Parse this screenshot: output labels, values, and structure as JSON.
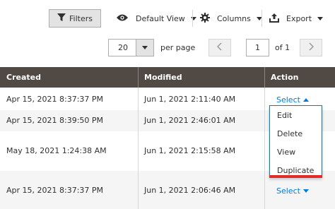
{
  "toolbar": {
    "filters_label": "Filters",
    "view_label": "Default View",
    "columns_label": "Columns",
    "export_label": "Export"
  },
  "pager": {
    "per_page_value": "20",
    "per_page_label": "per page",
    "current_page": "1",
    "of_pages": "of 1"
  },
  "table": {
    "headers": [
      "Created",
      "Modified",
      "Action"
    ],
    "rows": [
      {
        "created": "Apr 15, 2021 8:37:37 PM",
        "modified": "Jun 1, 2021 2:11:40 AM",
        "action": "Select"
      },
      {
        "created": "Apr 15, 2021 8:39:50 PM",
        "modified": "Jun 1, 2021 2:46:01 AM"
      },
      {
        "created": "May 18, 2021 1:24:38 AM",
        "modified": "Jun 1, 2021 2:15:58 AM"
      },
      {
        "created": "Apr 15, 2021 8:37:37 PM",
        "modified": "Jun 1, 2021 2:06:46 AM",
        "action": "Select"
      }
    ]
  },
  "action_menu": {
    "items": [
      "Edit",
      "Delete",
      "View",
      "Duplicate"
    ]
  },
  "colors": {
    "header_bg": "#514943",
    "link": "#007bdb",
    "highlight": "#e02b27"
  },
  "icons": {
    "filters": "funnel-icon",
    "view": "eye-icon",
    "columns": "gear-icon",
    "export": "export-icon"
  }
}
